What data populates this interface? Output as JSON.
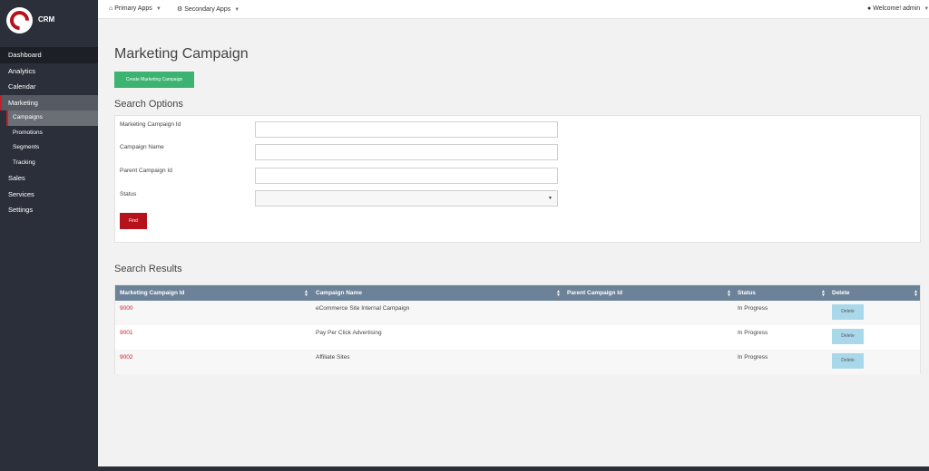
{
  "app": {
    "logo_text": "CRM"
  },
  "sidebar": {
    "items": [
      {
        "label": "Dashboard"
      },
      {
        "label": "Analytics"
      },
      {
        "label": "Calendar"
      },
      {
        "label": "Marketing"
      },
      {
        "label": "Campaigns"
      },
      {
        "label": "Promotions"
      },
      {
        "label": "Segments"
      },
      {
        "label": "Tracking"
      },
      {
        "label": "Sales"
      },
      {
        "label": "Services"
      },
      {
        "label": "Settings"
      }
    ]
  },
  "topbar": {
    "primary_apps": "Primary Apps",
    "secondary_apps": "Secondary Apps",
    "welcome": "Welcome! admin"
  },
  "main": {
    "title": "Marketing Campaign",
    "create_button": "Create Marketing Campaign",
    "search_title": "Search Options",
    "fields": [
      {
        "label": "Marketing Campaign Id",
        "value": ""
      },
      {
        "label": "Campaign Name",
        "value": ""
      },
      {
        "label": "Parent Campaign Id",
        "value": ""
      },
      {
        "label": "Status",
        "value": ""
      }
    ],
    "find_button": "Find",
    "results_title": "Search Results",
    "columns": [
      "Marketing Campaign Id",
      "Campaign Name",
      "Parent Campaign Id",
      "Status",
      "Delete"
    ],
    "rows": [
      {
        "id": "9000",
        "name": "eCommerce Site Internal Campaign",
        "parent": "",
        "status": "In Progress",
        "delete": "Delete"
      },
      {
        "id": "9001",
        "name": "Pay Per Click Advertising",
        "parent": "",
        "status": "In Progress",
        "delete": "Delete"
      },
      {
        "id": "9002",
        "name": "Affiliate Sites",
        "parent": "",
        "status": "In Progress",
        "delete": "Delete"
      }
    ]
  },
  "colors": {
    "accent_red": "#b5121b",
    "create_green": "#3cb371",
    "table_header": "#6c8299",
    "delete_button": "#a9d8ea",
    "sidebar_bg": "#2b2f3a"
  }
}
